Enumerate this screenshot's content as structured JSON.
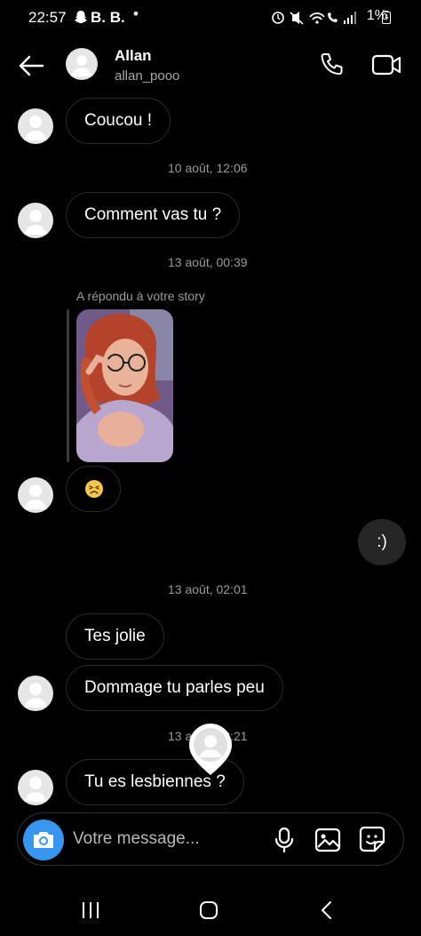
{
  "status_bar": {
    "time": "22:57",
    "carrier_text": "B. B.",
    "dot": "•",
    "battery": "1%"
  },
  "header": {
    "name": "Allan",
    "username": "allan_pooo"
  },
  "messages": {
    "m1": "Coucou !",
    "ts1": "10 août, 12:06",
    "m2": "Comment vas tu ?",
    "ts2": "13 août, 00:39",
    "reply_label": "A répondu à votre story",
    "sent1": ":)",
    "ts3": "13 août, 02:01",
    "m3": "Tes jolie",
    "m4": "Dommage tu parles peu",
    "ts4": "13 août, 02:21",
    "m5": "Tu es lesbiennes ?"
  },
  "composer": {
    "placeholder": "Votre message..."
  },
  "icons": [
    "arrow-back-icon",
    "phone-icon",
    "video-camera-icon",
    "camera-icon",
    "microphone-icon",
    "gallery-icon",
    "sticker-icon",
    "recent-apps-icon",
    "home-icon",
    "nav-back-icon"
  ],
  "colors": {
    "background": "#000000",
    "bubble_border": "#2b2b2b",
    "sent_bubble": "#262626",
    "camera_button": "#3797f0",
    "timestamp": "#9a9a9a"
  }
}
